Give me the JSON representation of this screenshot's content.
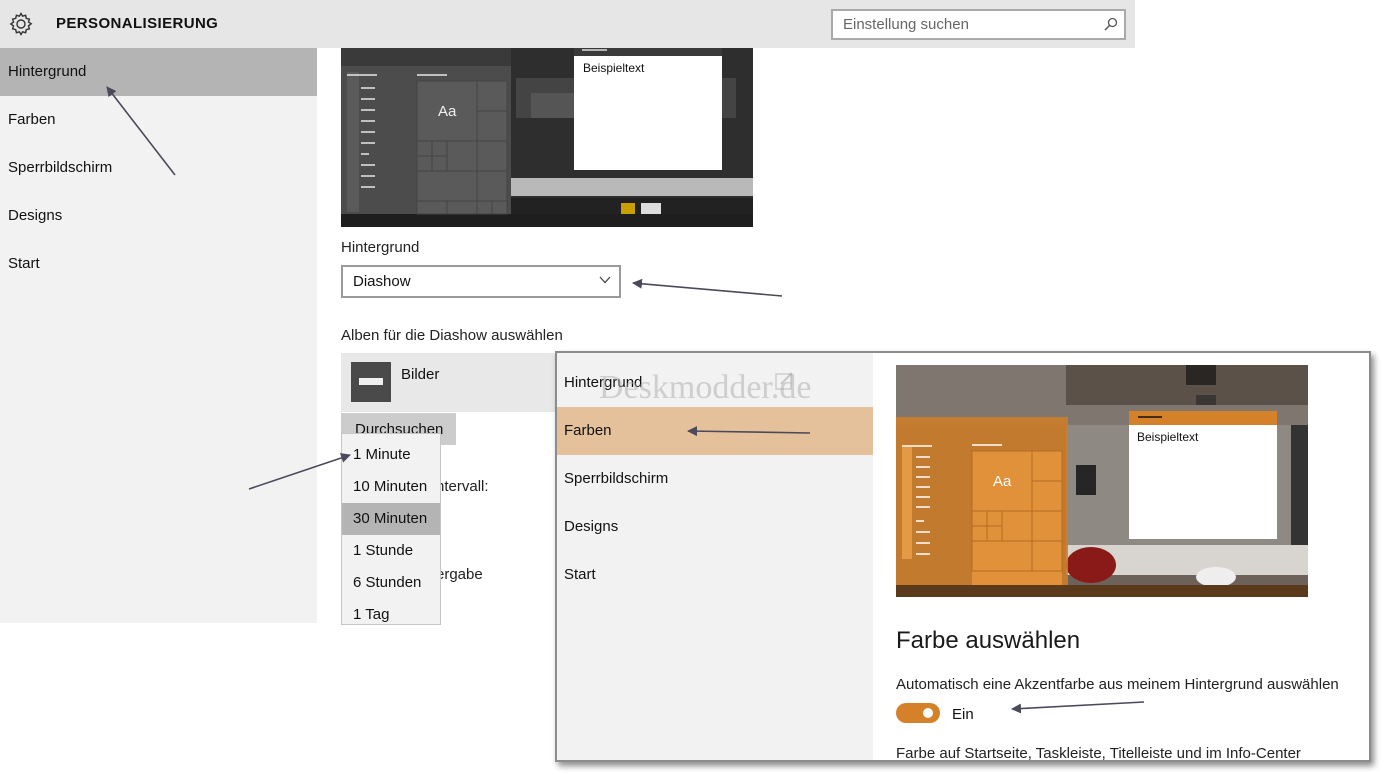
{
  "header": {
    "title": "PERSONALISIERUNG",
    "search_placeholder": "Einstellung suchen"
  },
  "sidebar": {
    "items": [
      {
        "label": "Hintergrund",
        "selected": true
      },
      {
        "label": "Farben"
      },
      {
        "label": "Sperrbildschirm"
      },
      {
        "label": "Designs"
      },
      {
        "label": "Start"
      }
    ]
  },
  "main": {
    "preview_sample_text": "Beispieltext",
    "preview_tile_text": "Aa",
    "background_label": "Hintergrund",
    "background_value": "Diashow",
    "albums_label": "Alben für die Diashow auswählen",
    "album_name": "Bilder",
    "browse_button": "Durchsuchen",
    "interval_partial": "ntervall:",
    "playback_partial": "ergabe",
    "interval_options": [
      {
        "label": "1 Minute"
      },
      {
        "label": "10 Minuten"
      },
      {
        "label": "30 Minuten",
        "selected": true
      },
      {
        "label": "1 Stunde"
      },
      {
        "label": "6 Stunden"
      },
      {
        "label": "1 Tag"
      }
    ]
  },
  "overlay": {
    "watermark": "Deskmodder.de",
    "sidebar_items": [
      {
        "label": "Hintergrund"
      },
      {
        "label": "Farben",
        "selected": true
      },
      {
        "label": "Sperrbildschirm"
      },
      {
        "label": "Designs"
      },
      {
        "label": "Start"
      }
    ],
    "preview_sample_text": "Beispieltext",
    "preview_tile_text": "Aa",
    "heading": "Farbe auswählen",
    "auto_accent_label": "Automatisch eine Akzentfarbe aus meinem Hintergrund auswählen",
    "toggle_state": "Ein",
    "accent_surfaces_label": "Farbe auf Startseite, Taskleiste, Titelleiste und im Info-Center"
  },
  "colors": {
    "accent_orange": "#d5812a",
    "selected_gray": "#b4b4b4",
    "selected_orange": "#e4c19b",
    "arrow": "#4a4a5a"
  },
  "icons": [
    "gear-icon",
    "search-icon",
    "chevron-down-icon",
    "drive-icon",
    "edit-icon"
  ]
}
